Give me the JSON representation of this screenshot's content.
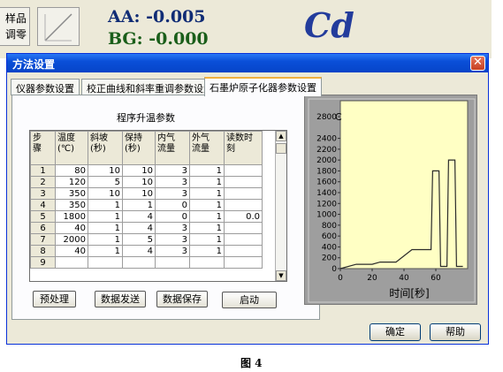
{
  "background": {
    "left_button_label": "样品\n调零",
    "aa_text": "AA: -0.005",
    "bg_text": "BG: -0.000",
    "element": "Cd"
  },
  "dialog": {
    "title": "方法设置",
    "close_symbol": "✕",
    "tabs": [
      "仪器参数设置",
      "校正曲线和斜率重调参数设置",
      "石墨炉原子化器参数设置"
    ],
    "active_tab": 2,
    "section_title": "程序升温参数",
    "table": {
      "headers": [
        "步\n骤",
        "温度\n(℃)",
        "斜坡\n(秒)",
        "保持\n(秒)",
        "内气\n流量",
        "外气\n流量",
        "读数时\n刻"
      ],
      "rows": [
        [
          "1",
          "80",
          "10",
          "10",
          "3",
          "1",
          ""
        ],
        [
          "2",
          "120",
          "5",
          "10",
          "3",
          "1",
          ""
        ],
        [
          "3",
          "350",
          "10",
          "10",
          "3",
          "1",
          ""
        ],
        [
          "4",
          "350",
          "1",
          "1",
          "0",
          "1",
          ""
        ],
        [
          "5",
          "1800",
          "1",
          "4",
          "0",
          "1",
          "0.0"
        ],
        [
          "6",
          "40",
          "1",
          "4",
          "3",
          "1",
          ""
        ],
        [
          "7",
          "2000",
          "1",
          "5",
          "3",
          "1",
          ""
        ],
        [
          "8",
          "40",
          "1",
          "4",
          "3",
          "1",
          ""
        ],
        [
          "9",
          "",
          "",
          "",
          "",
          "",
          ""
        ]
      ]
    },
    "buttons": {
      "preprocess": "预处理",
      "send_data": "数据发送",
      "save_data": "数据保存",
      "start": "启动",
      "ok": "确定",
      "help": "帮助"
    }
  },
  "chart_data": {
    "type": "line",
    "xlabel": "时间[秒]",
    "ylabel": "C",
    "xlim": [
      0,
      80
    ],
    "ylim": [
      0,
      2800
    ],
    "x_ticks": [
      0,
      20,
      40,
      60
    ],
    "y_ticks": [
      0,
      200,
      400,
      600,
      800,
      1000,
      1200,
      1400,
      1600,
      1800,
      2000,
      2200,
      2400,
      2800
    ],
    "series": [
      {
        "x": [
          0,
          10,
          20,
          25,
          35,
          45,
          46,
          57,
          58,
          62,
          63,
          67,
          68,
          72,
          73,
          77
        ],
        "y": [
          0,
          80,
          80,
          120,
          120,
          350,
          350,
          350,
          1800,
          1800,
          40,
          40,
          2000,
          2000,
          40,
          40
        ]
      }
    ],
    "background_color": "#ffffc4",
    "line_color": "#2b2b2b"
  },
  "caption": "图 4"
}
